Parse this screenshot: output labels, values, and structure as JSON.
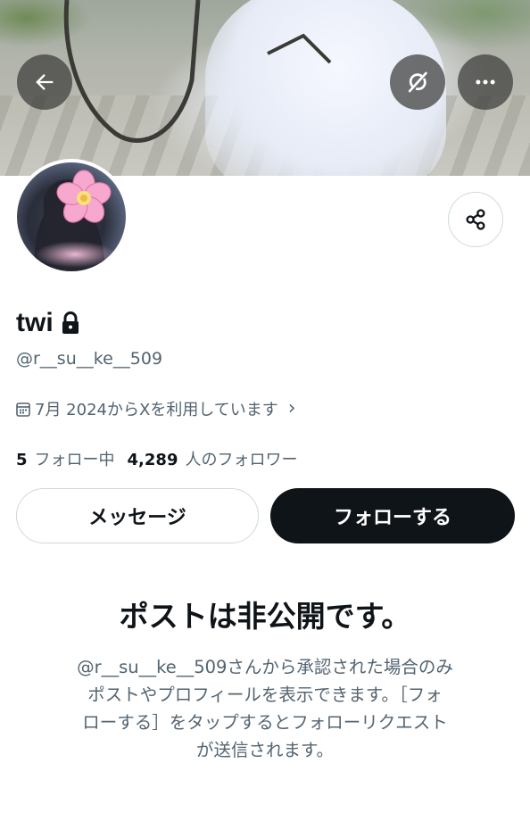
{
  "header": {
    "back_icon": "arrow-left-icon",
    "grok_icon": "grok-icon",
    "more_icon": "more-horizontal-icon"
  },
  "profile": {
    "avatar_icon": "cherry-blossom-icon",
    "share_icon": "share-icon",
    "name": "twi",
    "lock_icon": "lock-icon",
    "handle": "@r__su__ke__509",
    "calendar_icon": "calendar-icon",
    "joined": "7月 2024からXを利用しています",
    "joined_chevron": "›",
    "following_count": "5",
    "following_label": "フォロー中",
    "followers_count": "4,289",
    "followers_label": "人のフォロワー"
  },
  "actions": {
    "message_label": "メッセージ",
    "follow_label": "フォローする"
  },
  "private_notice": {
    "title": "ポストは非公開です。",
    "lines": [
      "@r__su__ke__509さんから承認された場合のみ",
      "ポストやプロフィールを表示できます。［フォ",
      "ローする］をタップするとフォローリクエスト",
      "が送信されます。"
    ]
  },
  "colors": {
    "text_primary": "#0f1419",
    "text_secondary": "#536471",
    "border": "#cfd9de",
    "follow_bg": "#0f1419"
  }
}
